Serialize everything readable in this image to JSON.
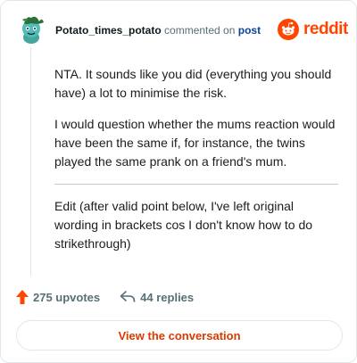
{
  "comment": {
    "author": "Potato_times_potato",
    "commented_on_text": "commented on",
    "post_link": "post",
    "paragraphs": [
      "NTA. It sounds like you did (everything you should have) a lot to minimise the risk.",
      "I would question whether the mums reaction would have been the same if, for instance, the twins played the same prank on a friend's mum.",
      "Edit (after valid point below, I've left original wording in brackets cos I don't know how to do strikethrough)"
    ]
  },
  "brand": {
    "wordmark": "reddit",
    "icon": "reddit-snoo-icon",
    "color": "#ff4500"
  },
  "stats": {
    "upvotes": "275 upvotes",
    "replies": "44 replies",
    "upvote_icon": "upvote-arrow-icon",
    "reply_icon": "reply-arrow-icon",
    "upvote_color": "#ff4500"
  },
  "cta": {
    "label": "View the conversation",
    "color": "#d93a00"
  },
  "avatar": {
    "icon": "snoo-avatar-icon",
    "background": "#4fbdba"
  }
}
